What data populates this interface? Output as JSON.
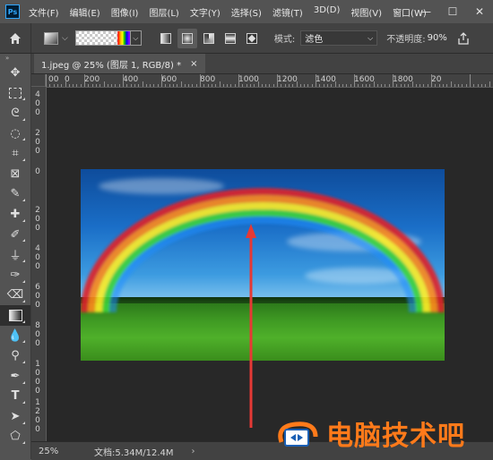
{
  "menu": {
    "items": [
      "文件(F)",
      "编辑(E)",
      "图像(I)",
      "图层(L)",
      "文字(Y)",
      "选择(S)",
      "滤镜(T)",
      "3D(D)",
      "视图(V)",
      "窗口(W)"
    ]
  },
  "window_controls": {
    "minimize": "—",
    "maximize": "☐",
    "close": "✕"
  },
  "options": {
    "mode_label": "模式:",
    "mode_value": "滤色",
    "opacity_label": "不透明度:",
    "opacity_value": "90%"
  },
  "document_tab": {
    "title": "1.jpeg @ 25% (图层 1, RGB/8) *",
    "close": "×"
  },
  "ruler": {
    "h_labels": [
      "00",
      "0",
      "200",
      "400",
      "600",
      "800",
      "1000",
      "1200",
      "1400",
      "1600",
      "1800",
      "20"
    ],
    "v_labels": [
      "400",
      "200",
      "0",
      "200",
      "400",
      "600",
      "800",
      "1000",
      "1200"
    ]
  },
  "status": {
    "zoom": "25%",
    "doc_info": "文档:5.34M/12.4M",
    "arrow": "›"
  },
  "watermark": {
    "text": "电脑技术吧"
  },
  "colors": {
    "accent_orange": "#ff7a1a",
    "rainbow_arrow": "#e53935"
  }
}
